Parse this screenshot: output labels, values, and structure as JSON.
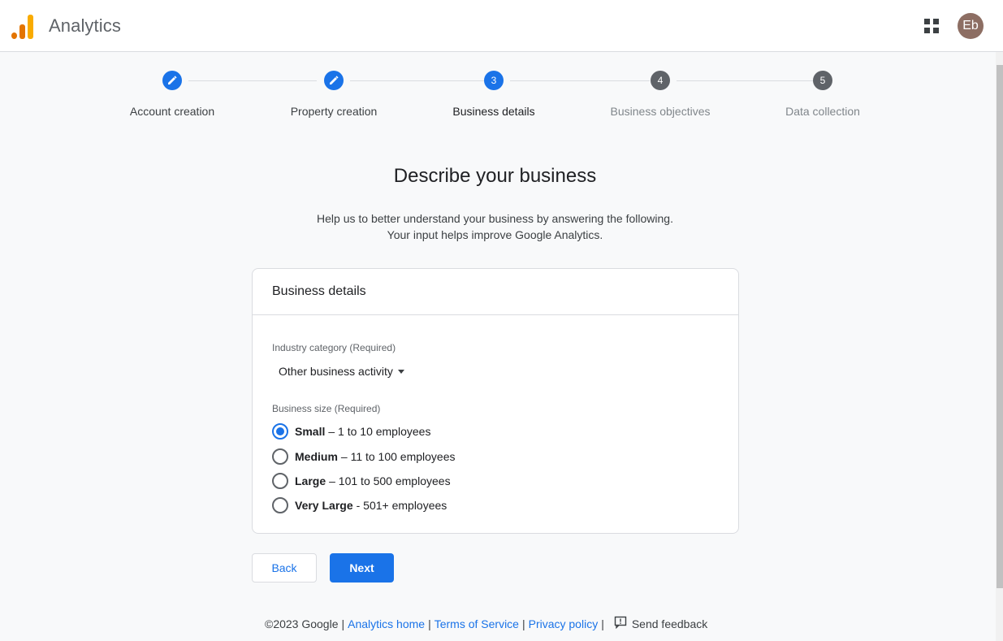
{
  "header": {
    "app_title": "Analytics",
    "avatar_initials": "Eb",
    "apps_icon": "apps-grid-icon",
    "logo_colors": [
      "#e37400",
      "#e37400",
      "#f9ab00"
    ]
  },
  "stepper": {
    "steps": [
      {
        "number": "1",
        "label": "Account creation",
        "state": "done"
      },
      {
        "number": "2",
        "label": "Property creation",
        "state": "done"
      },
      {
        "number": "3",
        "label": "Business details",
        "state": "active"
      },
      {
        "number": "4",
        "label": "Business objectives",
        "state": "future"
      },
      {
        "number": "5",
        "label": "Data collection",
        "state": "future"
      }
    ]
  },
  "main": {
    "headline": "Describe your business",
    "subtext_line1": "Help us to better understand your business by answering the following.",
    "subtext_line2": "Your input helps improve Google Analytics."
  },
  "card": {
    "title": "Business details",
    "industry_label": "Industry category (Required)",
    "industry_value": "Other business activity",
    "size_label": "Business size (Required)",
    "size_options": [
      {
        "name": "Small",
        "detail": "– 1 to 10 employees",
        "checked": true
      },
      {
        "name": "Medium",
        "detail": "– 11 to 100 employees",
        "checked": false
      },
      {
        "name": "Large",
        "detail": "– 101 to 500 employees",
        "checked": false
      },
      {
        "name": "Very Large",
        "detail": "- 501+ employees",
        "checked": false
      }
    ]
  },
  "buttons": {
    "back": "Back",
    "next": "Next"
  },
  "footer": {
    "copyright": "©2023 Google",
    "analytics_home": "Analytics home",
    "terms": "Terms of Service",
    "privacy": "Privacy policy",
    "feedback": "Send feedback",
    "separator": "|"
  },
  "colors": {
    "accent": "#1a73e8",
    "future_step": "#5f6368",
    "avatar_bg": "#8d6e63"
  }
}
